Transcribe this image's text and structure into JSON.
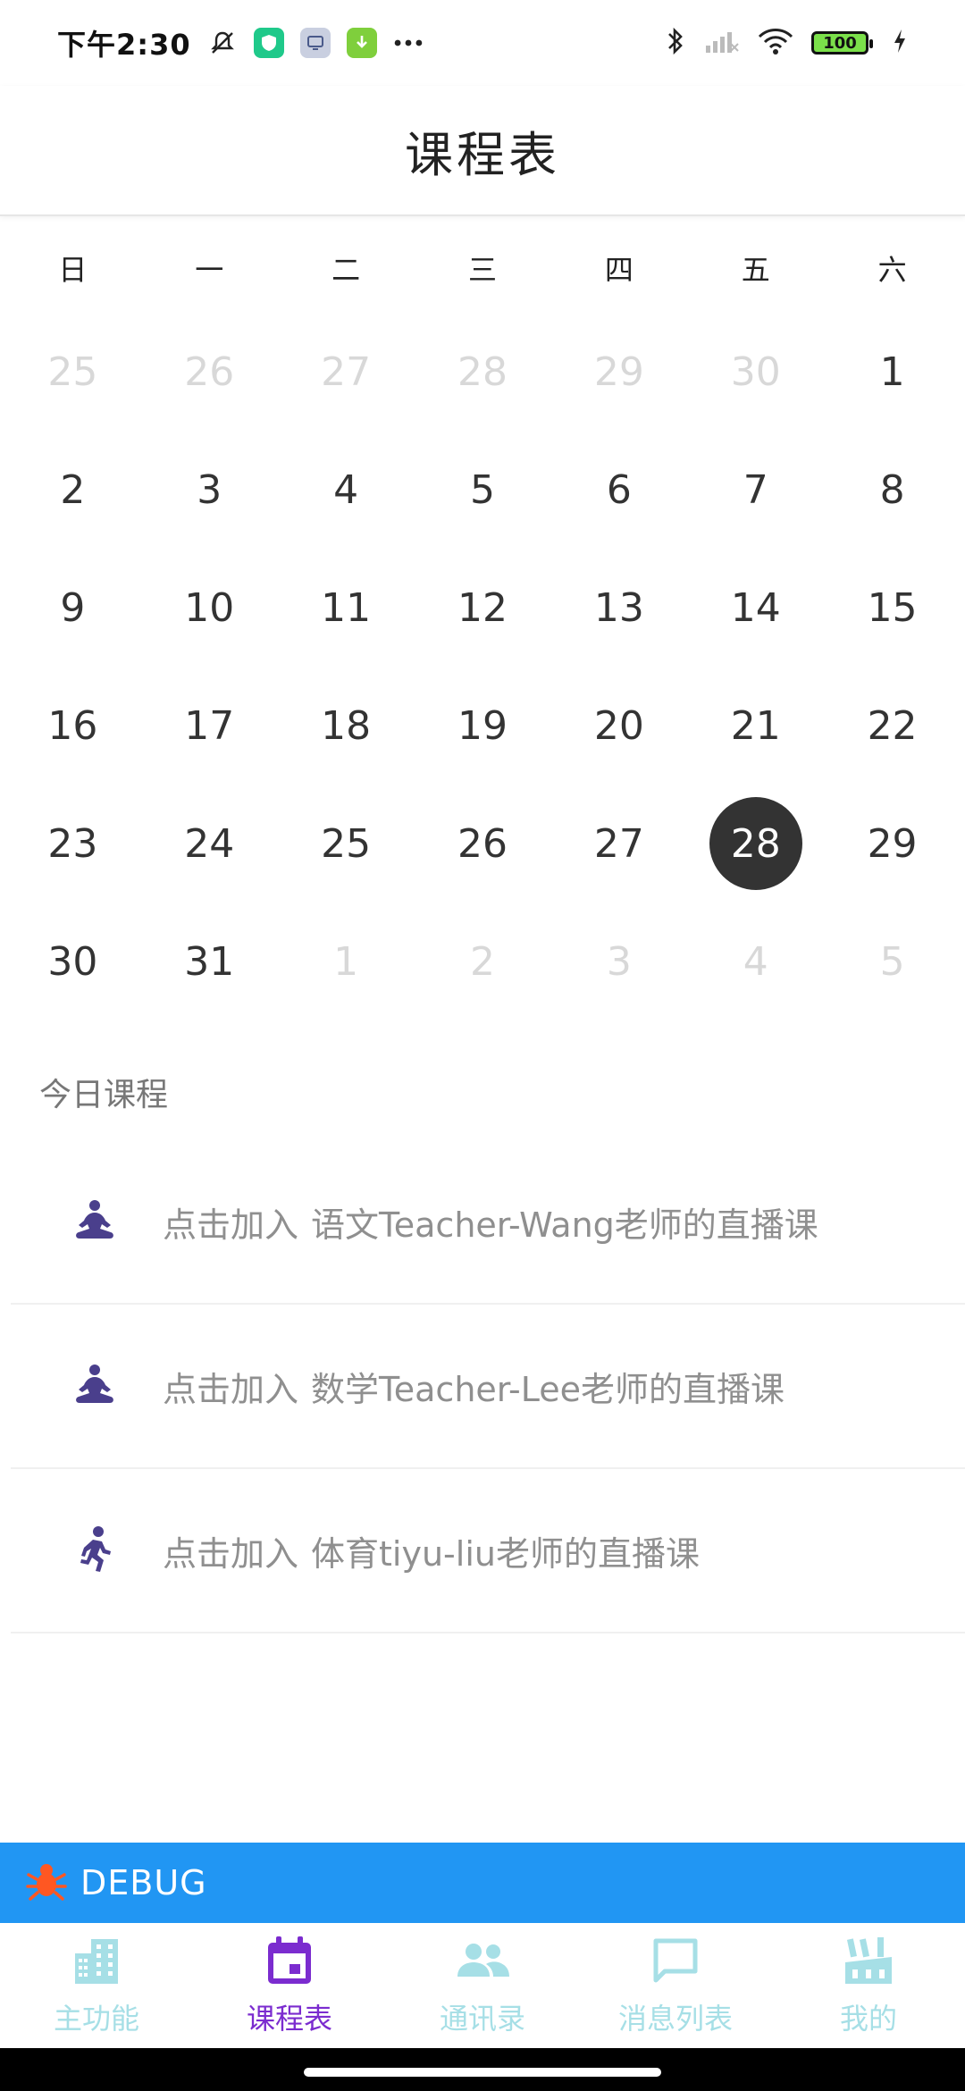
{
  "status": {
    "time": "下午2:30",
    "battery": "100"
  },
  "app": {
    "title": "课程表"
  },
  "calendar": {
    "weekdays": [
      "日",
      "一",
      "二",
      "三",
      "四",
      "五",
      "六"
    ],
    "selected": "28",
    "days": [
      {
        "label": "25",
        "muted": true
      },
      {
        "label": "26",
        "muted": true
      },
      {
        "label": "27",
        "muted": true
      },
      {
        "label": "28",
        "muted": true
      },
      {
        "label": "29",
        "muted": true
      },
      {
        "label": "30",
        "muted": true
      },
      {
        "label": "1",
        "muted": false
      },
      {
        "label": "2",
        "muted": false
      },
      {
        "label": "3",
        "muted": false
      },
      {
        "label": "4",
        "muted": false
      },
      {
        "label": "5",
        "muted": false
      },
      {
        "label": "6",
        "muted": false
      },
      {
        "label": "7",
        "muted": false
      },
      {
        "label": "8",
        "muted": false
      },
      {
        "label": "9",
        "muted": false
      },
      {
        "label": "10",
        "muted": false
      },
      {
        "label": "11",
        "muted": false
      },
      {
        "label": "12",
        "muted": false
      },
      {
        "label": "13",
        "muted": false
      },
      {
        "label": "14",
        "muted": false
      },
      {
        "label": "15",
        "muted": false
      },
      {
        "label": "16",
        "muted": false
      },
      {
        "label": "17",
        "muted": false
      },
      {
        "label": "18",
        "muted": false
      },
      {
        "label": "19",
        "muted": false
      },
      {
        "label": "20",
        "muted": false
      },
      {
        "label": "21",
        "muted": false
      },
      {
        "label": "22",
        "muted": false
      },
      {
        "label": "23",
        "muted": false
      },
      {
        "label": "24",
        "muted": false
      },
      {
        "label": "25",
        "muted": false
      },
      {
        "label": "26",
        "muted": false
      },
      {
        "label": "27",
        "muted": false
      },
      {
        "label": "28",
        "muted": false,
        "selected": true
      },
      {
        "label": "29",
        "muted": false
      },
      {
        "label": "30",
        "muted": false
      },
      {
        "label": "31",
        "muted": false
      },
      {
        "label": "1",
        "muted": true
      },
      {
        "label": "2",
        "muted": true
      },
      {
        "label": "3",
        "muted": true
      },
      {
        "label": "4",
        "muted": true
      },
      {
        "label": "5",
        "muted": true
      }
    ]
  },
  "today": {
    "title": "今日课程",
    "courses": [
      {
        "prefix": "点击加入",
        "text": "语文Teacher-Wang老师的直播课",
        "icon": "meditation-icon"
      },
      {
        "prefix": "点击加入",
        "text": "数学Teacher-Lee老师的直播课",
        "icon": "meditation-icon"
      },
      {
        "prefix": "点击加入",
        "text": "体育tiyu-liu老师的直播课",
        "icon": "running-icon"
      }
    ]
  },
  "debug": {
    "label": "DEBUG"
  },
  "nav": {
    "items": [
      {
        "label": "主功能",
        "icon": "buildings-icon",
        "active": false
      },
      {
        "label": "课程表",
        "icon": "calendar-icon",
        "active": true
      },
      {
        "label": "通讯录",
        "icon": "people-icon",
        "active": false
      },
      {
        "label": "消息列表",
        "icon": "chat-icon",
        "active": false
      },
      {
        "label": "我的",
        "icon": "factory-icon",
        "active": false
      }
    ]
  },
  "colors": {
    "accent": "#7b2ccf",
    "nav_inactive": "#a6dfe6",
    "debug_bar": "#2196f3",
    "course_icon": "#4a3f8c",
    "selected_day_bg": "#333333"
  }
}
